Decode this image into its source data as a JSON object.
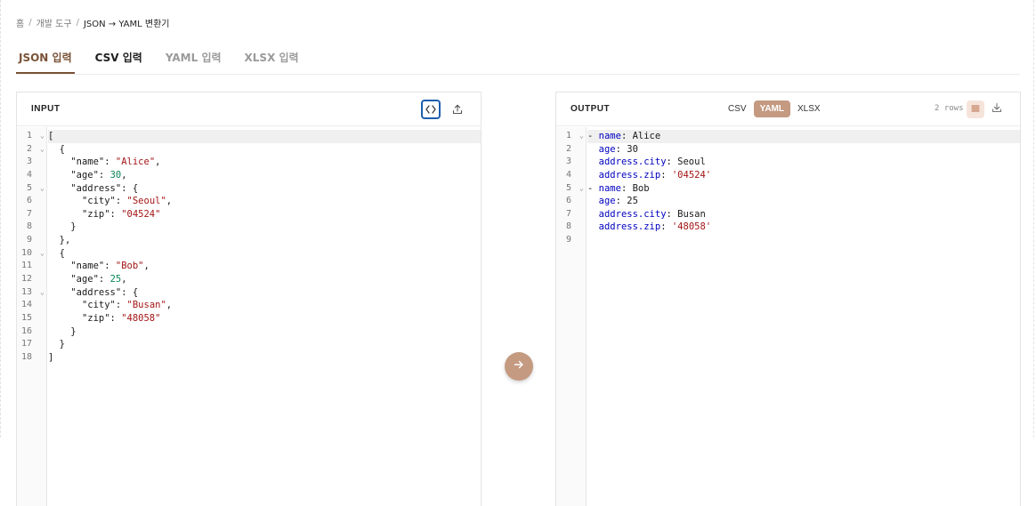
{
  "breadcrumb": {
    "home": "홈",
    "section": "개발 도구",
    "current": "JSON → YAML 변환기",
    "separator": "/"
  },
  "tabs": [
    {
      "label": "JSON 입력",
      "state": "active"
    },
    {
      "label": "CSV 입력",
      "state": "strong"
    },
    {
      "label": "YAML 입력",
      "state": "normal"
    },
    {
      "label": "XLSX 입력",
      "state": "normal"
    }
  ],
  "input_panel": {
    "title": "INPUT",
    "format_icon": "code-brackets-icon",
    "upload_icon": "upload-icon",
    "lines": [
      {
        "n": "1",
        "fold": true,
        "tokens": [
          [
            "punc",
            "["
          ]
        ]
      },
      {
        "n": "2",
        "fold": true,
        "tokens": [
          [
            "punc",
            "  {"
          ]
        ]
      },
      {
        "n": "3",
        "fold": false,
        "tokens": [
          [
            "punc",
            "    "
          ],
          [
            "key",
            "\"name\""
          ],
          [
            "punc",
            ": "
          ],
          [
            "str",
            "\"Alice\""
          ],
          [
            "punc",
            ","
          ]
        ]
      },
      {
        "n": "4",
        "fold": false,
        "tokens": [
          [
            "punc",
            "    "
          ],
          [
            "key",
            "\"age\""
          ],
          [
            "punc",
            ": "
          ],
          [
            "num",
            "30"
          ],
          [
            "punc",
            ","
          ]
        ]
      },
      {
        "n": "5",
        "fold": true,
        "tokens": [
          [
            "punc",
            "    "
          ],
          [
            "key",
            "\"address\""
          ],
          [
            "punc",
            ": {"
          ]
        ]
      },
      {
        "n": "6",
        "fold": false,
        "tokens": [
          [
            "punc",
            "      "
          ],
          [
            "key",
            "\"city\""
          ],
          [
            "punc",
            ": "
          ],
          [
            "str",
            "\"Seoul\""
          ],
          [
            "punc",
            ","
          ]
        ]
      },
      {
        "n": "7",
        "fold": false,
        "tokens": [
          [
            "punc",
            "      "
          ],
          [
            "key",
            "\"zip\""
          ],
          [
            "punc",
            ": "
          ],
          [
            "str",
            "\"04524\""
          ]
        ]
      },
      {
        "n": "8",
        "fold": false,
        "tokens": [
          [
            "punc",
            "    }"
          ]
        ]
      },
      {
        "n": "9",
        "fold": false,
        "tokens": [
          [
            "punc",
            "  },"
          ]
        ]
      },
      {
        "n": "10",
        "fold": true,
        "tokens": [
          [
            "punc",
            "  {"
          ]
        ]
      },
      {
        "n": "11",
        "fold": false,
        "tokens": [
          [
            "punc",
            "    "
          ],
          [
            "key",
            "\"name\""
          ],
          [
            "punc",
            ": "
          ],
          [
            "str",
            "\"Bob\""
          ],
          [
            "punc",
            ","
          ]
        ]
      },
      {
        "n": "12",
        "fold": false,
        "tokens": [
          [
            "punc",
            "    "
          ],
          [
            "key",
            "\"age\""
          ],
          [
            "punc",
            ": "
          ],
          [
            "num",
            "25"
          ],
          [
            "punc",
            ","
          ]
        ]
      },
      {
        "n": "13",
        "fold": true,
        "tokens": [
          [
            "punc",
            "    "
          ],
          [
            "key",
            "\"address\""
          ],
          [
            "punc",
            ": {"
          ]
        ]
      },
      {
        "n": "14",
        "fold": false,
        "tokens": [
          [
            "punc",
            "      "
          ],
          [
            "key",
            "\"city\""
          ],
          [
            "punc",
            ": "
          ],
          [
            "str",
            "\"Busan\""
          ],
          [
            "punc",
            ","
          ]
        ]
      },
      {
        "n": "15",
        "fold": false,
        "tokens": [
          [
            "punc",
            "      "
          ],
          [
            "key",
            "\"zip\""
          ],
          [
            "punc",
            ": "
          ],
          [
            "str",
            "\"48058\""
          ]
        ]
      },
      {
        "n": "16",
        "fold": false,
        "tokens": [
          [
            "punc",
            "    }"
          ]
        ]
      },
      {
        "n": "17",
        "fold": false,
        "tokens": [
          [
            "punc",
            "  }"
          ]
        ]
      },
      {
        "n": "18",
        "fold": false,
        "tokens": [
          [
            "punc",
            "]"
          ]
        ]
      }
    ]
  },
  "output_panel": {
    "title": "OUTPUT",
    "formats": [
      {
        "label": "CSV",
        "active": false
      },
      {
        "label": "YAML",
        "active": true
      },
      {
        "label": "XLSX",
        "active": false
      }
    ],
    "rows_count": "2 rows",
    "list_icon": "list-view-icon",
    "download_icon": "download-icon",
    "lines": [
      {
        "n": "1",
        "fold": true,
        "tokens": [
          [
            "dash",
            "- "
          ],
          [
            "ykey",
            "name"
          ],
          [
            "yval",
            ": Alice"
          ]
        ]
      },
      {
        "n": "2",
        "fold": false,
        "tokens": [
          [
            "yval",
            "  "
          ],
          [
            "ykey",
            "age"
          ],
          [
            "yval",
            ": 30"
          ]
        ]
      },
      {
        "n": "3",
        "fold": false,
        "tokens": [
          [
            "yval",
            "  "
          ],
          [
            "ykey",
            "address.city"
          ],
          [
            "yval",
            ": Seoul"
          ]
        ]
      },
      {
        "n": "4",
        "fold": false,
        "tokens": [
          [
            "yval",
            "  "
          ],
          [
            "ykey",
            "address.zip"
          ],
          [
            "yval",
            ": "
          ],
          [
            "ystr",
            "'04524'"
          ]
        ]
      },
      {
        "n": "5",
        "fold": true,
        "tokens": [
          [
            "dash",
            "- "
          ],
          [
            "ykey",
            "name"
          ],
          [
            "yval",
            ": Bob"
          ]
        ]
      },
      {
        "n": "6",
        "fold": false,
        "tokens": [
          [
            "yval",
            "  "
          ],
          [
            "ykey",
            "age"
          ],
          [
            "yval",
            ": 25"
          ]
        ]
      },
      {
        "n": "7",
        "fold": false,
        "tokens": [
          [
            "yval",
            "  "
          ],
          [
            "ykey",
            "address.city"
          ],
          [
            "yval",
            ": Busan"
          ]
        ]
      },
      {
        "n": "8",
        "fold": false,
        "tokens": [
          [
            "yval",
            "  "
          ],
          [
            "ykey",
            "address.zip"
          ],
          [
            "yval",
            ": "
          ],
          [
            "ystr",
            "'48058'"
          ]
        ]
      },
      {
        "n": "9",
        "fold": false,
        "tokens": []
      }
    ]
  },
  "convert_button": {
    "icon": "arrow-right-icon"
  },
  "colors": {
    "accent": "#c49a80",
    "active_tab": "#7a5236",
    "focus_ring": "#1f5fae",
    "string": "#a31515",
    "number": "#098658",
    "yaml_key": "#0000c0"
  }
}
